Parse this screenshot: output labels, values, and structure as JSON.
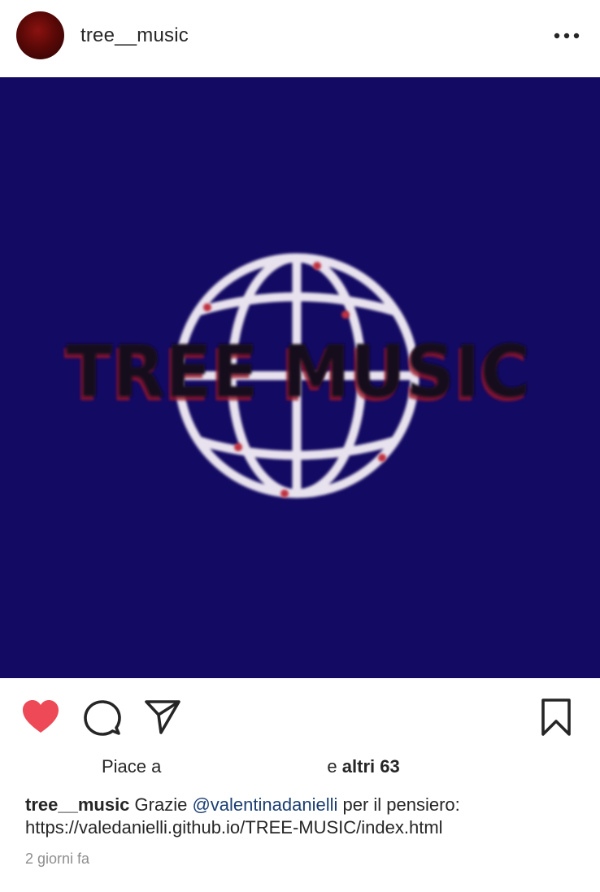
{
  "post": {
    "username": "tree__music",
    "image_text": "TREE MUSIC",
    "image_bg": "#130a63"
  },
  "likes": {
    "prefix": "Piace a",
    "suffix": "e",
    "others": "altri 63"
  },
  "caption": {
    "username": "tree__music",
    "text_1": "Grazie",
    "mention": "@valentinadanielli",
    "text_2": "per il pensiero:",
    "link": "https://valedanielli.github.io/TREE-MUSIC/index.html"
  },
  "timestamp": "2 giorni fa",
  "icons": {
    "more": "more-options-icon",
    "like": "heart-icon",
    "comment": "comment-icon",
    "share": "share-icon",
    "save": "bookmark-icon"
  },
  "colors": {
    "like_red": "#ed4956",
    "mention_blue": "#1b3e72",
    "meta_gray": "#8e8e8e"
  }
}
